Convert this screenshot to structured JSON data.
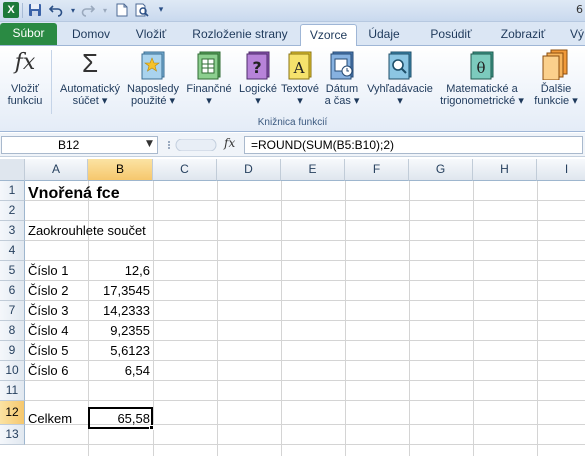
{
  "quick_access": {
    "app_icon": "X",
    "icons": [
      "save-icon",
      "undo-icon",
      "redo-icon",
      "new-document-icon",
      "print-preview-icon",
      "customize-dropdown-icon"
    ],
    "right_partial": "6"
  },
  "tabs": [
    {
      "label": "Súbor"
    },
    {
      "label": "Domov"
    },
    {
      "label": "Vložiť"
    },
    {
      "label": "Rozloženie strany"
    },
    {
      "label": "Vzorce"
    },
    {
      "label": "Údaje"
    },
    {
      "label": "Posúdiť"
    },
    {
      "label": "Zobraziť"
    },
    {
      "label": "Vý"
    }
  ],
  "ribbon": {
    "insert_function": {
      "line1": "Vložiť",
      "line2": "funkciu"
    },
    "autosum": {
      "line1": "Automatický",
      "line2": "súčet"
    },
    "recent": {
      "line1": "Naposledy",
      "line2": "použité"
    },
    "financial": {
      "line1": "Finančné"
    },
    "logical": {
      "line1": "Logické"
    },
    "text": {
      "line1": "Textové"
    },
    "datetime": {
      "line1": "Dátum",
      "line2": "a čas"
    },
    "lookup": {
      "line1": "Vyhľadávacie"
    },
    "math": {
      "line1": "Matematické a",
      "line2": "trigonometrické"
    },
    "more": {
      "line1": "Ďalšie",
      "line2": "funkcie"
    },
    "group_label": "Knižnica funkcií"
  },
  "formula_bar": {
    "name_box": "B12",
    "fx": "fx",
    "formula": "=ROUND(SUM(B5:B10);2)"
  },
  "grid": {
    "columns": [
      "A",
      "B",
      "C",
      "D",
      "E",
      "F",
      "G",
      "H",
      "I"
    ],
    "rows": [
      "1",
      "2",
      "3",
      "4",
      "5",
      "6",
      "7",
      "8",
      "9",
      "10",
      "11",
      "12",
      "13"
    ],
    "selected_column": "B",
    "selected_row": "12",
    "cells": {
      "a1": "Vnořená fce",
      "a3": "Zaokrouhlete součet",
      "a5": "Číslo 1",
      "b5": "12,6",
      "a6": "Číslo 2",
      "b6": "17,3545",
      "a7": "Číslo 3",
      "b7": "14,2333",
      "a8": "Číslo 4",
      "b8": "9,2355",
      "a9": "Číslo 5",
      "b9": "5,6123",
      "a10": "Číslo 6",
      "b10": "6,54",
      "a12": "Celkem",
      "b12": "65,58"
    }
  }
}
